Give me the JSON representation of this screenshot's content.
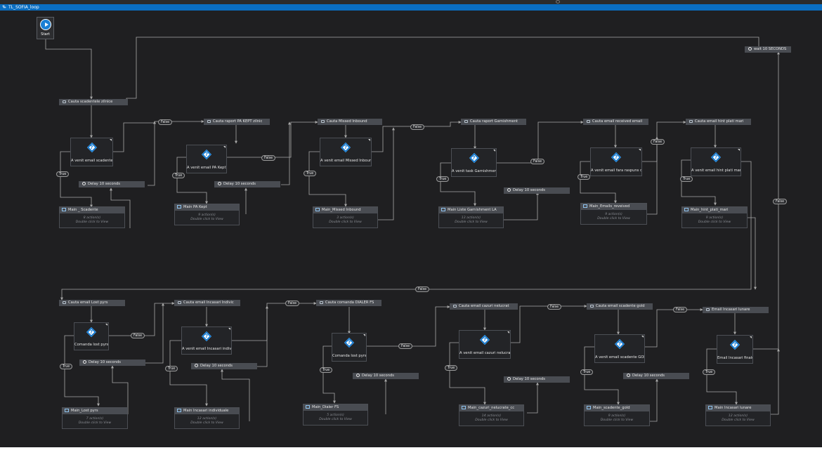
{
  "window": {
    "title": "TL_SOFIA_loop"
  },
  "start": {
    "label": "Start"
  },
  "wait_node": {
    "label": "wait 10 SECONDS"
  },
  "row1": [
    {
      "seq": "Cauta scadentele zilnice",
      "decision": "A venit email scadente?",
      "delay": "Delay 10 seconds",
      "workflow": "Main _ Scadente",
      "actions": "8 action(s)",
      "hint": "Double click to View"
    },
    {
      "seq": "Cauta raport PA KEPT zilnic",
      "decision": "A venit email PA Kept?",
      "delay": "Delay 10 seconds",
      "workflow": "Main PA Kept",
      "actions": "9 action(s)",
      "hint": "Double click to View"
    },
    {
      "seq": "Cauta Missed Inbound",
      "decision": "A venit email Missed Inbound",
      "delay": "",
      "workflow": "Main_Missed Inbound",
      "actions": "3 action(s)",
      "hint": "Double click to View"
    },
    {
      "seq": "Cauta raport Garnishment",
      "decision": "A venit task Garnishment?",
      "delay": "Delay 10 seconds",
      "workflow": "Main Liste Garnishment LA",
      "actions": "13 action(s)",
      "hint": "Double click to View"
    },
    {
      "seq": "Cauta email received email",
      "decision": "A venit email fara raspuns del",
      "delay": "",
      "workflow": "Main_Emails_reveived",
      "actions": "9 action(s)",
      "hint": "Double click to View"
    },
    {
      "seq": "Cauta email hint plati mari",
      "decision": "A venit email hint plati mari?",
      "delay": "",
      "workflow": "Main_hint_plati_mari",
      "actions": "9 action(s)",
      "hint": "Double click to View"
    }
  ],
  "row2": [
    {
      "seq": "Cauta email Lost pyrs",
      "decision": "Comanda lost pyrs?",
      "delay": "Delay 10 seconds",
      "workflow": "Main_Lost pyrs",
      "actions": "7 action(s)",
      "hint": "Double click to View"
    },
    {
      "seq": "Cauta email Incasari Indivic",
      "decision": "A venit email Incasari individu",
      "delay": "Delay 10 seconds",
      "workflow": "Main Incasari individuale",
      "actions": "12 action(s)",
      "hint": "Double click to View"
    },
    {
      "seq": "Cauta comanda DIALER FS",
      "decision": "Comanda lost pyrs?",
      "delay": "Delay 10 seconds",
      "workflow": "Main_Dialer FS",
      "actions": "5 action(s)",
      "hint": "Double click to View"
    },
    {
      "seq": "Cauta email cazuri nelucrat",
      "decision": "A venit email cazuri nelucrate",
      "delay": "Delay 10 seconds",
      "workflow": "Main_cazuri_nelucrate_cc",
      "actions": "14 action(s)",
      "hint": "Double click to View"
    },
    {
      "seq": "Cauta email scadente gold",
      "decision": "A venit email scadente GOLD",
      "delay": "Delay 10 seconds",
      "workflow": "Main_scadente_gold",
      "actions": "9 action(s)",
      "hint": "Double click to View"
    },
    {
      "seq": "Email Incasari lunare",
      "decision": "Email Incasari finale?",
      "delay": "",
      "workflow": "Main Incasari lunare",
      "actions": "12 action(s)",
      "hint": "Double click to View"
    }
  ],
  "edge_labels": {
    "true": "True",
    "false": "False"
  },
  "colors": {
    "canvas": "#1f1f21",
    "node": "#494c52",
    "titlebar": "#0a6ec1",
    "accent": "#1b7fd4",
    "wire": "#a8a8a8"
  }
}
